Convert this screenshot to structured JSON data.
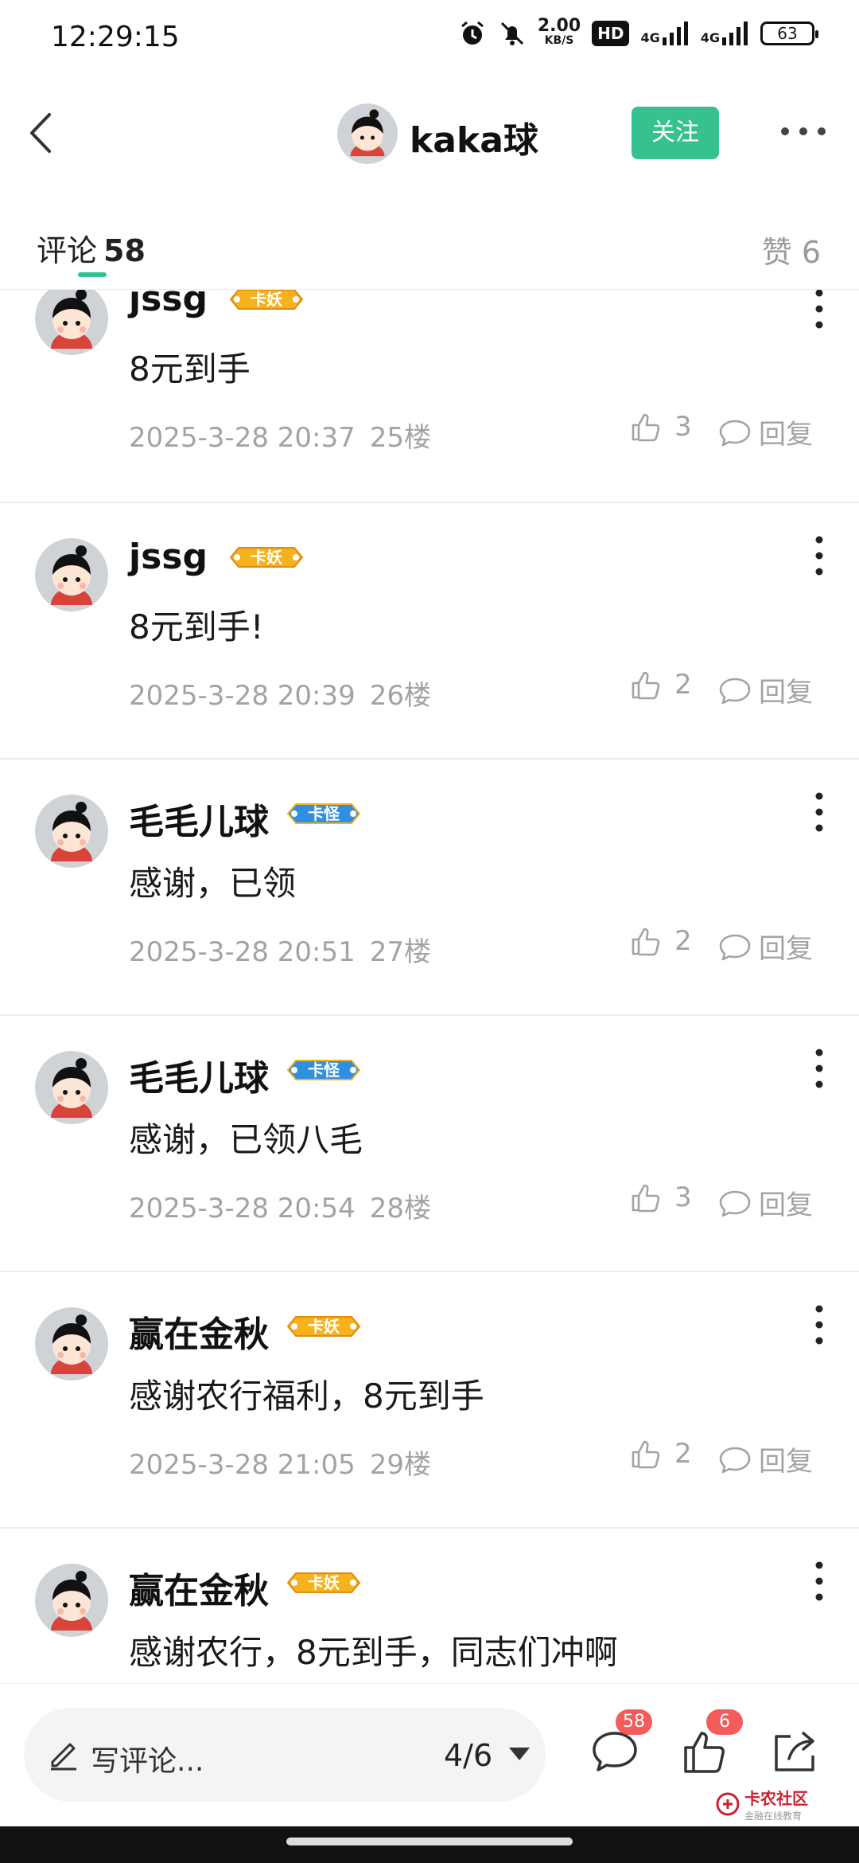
{
  "status_bar": {
    "time": "12:29:15",
    "net_speed_value": "2.00",
    "net_speed_unit": "KB/S",
    "hd_label": "HD",
    "signal1_label": "4G",
    "signal2_label": "4G",
    "battery": "63",
    "icons": [
      "alarm-icon",
      "mute-icon",
      "hd-icon",
      "signal-icon",
      "signal-icon",
      "battery-icon"
    ]
  },
  "header": {
    "user_name": "kaka球",
    "follow_label": "关注",
    "accent_color": "#35c28f"
  },
  "tabs": {
    "comments_label": "评论",
    "comments_count": "58",
    "likes_label": "赞 6"
  },
  "comments": [
    {
      "name": "jssg",
      "badge": "卡妖",
      "text": "8元到手",
      "time": "2025-3-28 20:37",
      "floor": "25楼",
      "likes": "3",
      "reply_label": "回复"
    },
    {
      "name": "jssg",
      "badge": "卡妖",
      "text": "8元到手!",
      "time": "2025-3-28 20:39",
      "floor": "26楼",
      "likes": "2",
      "reply_label": "回复"
    },
    {
      "name": "毛毛儿球",
      "badge": "卡怪",
      "text": "感谢，已领",
      "time": "2025-3-28 20:51",
      "floor": "27楼",
      "likes": "2",
      "reply_label": "回复"
    },
    {
      "name": "毛毛儿球",
      "badge": "卡怪",
      "text": "感谢，已领八毛",
      "time": "2025-3-28 20:54",
      "floor": "28楼",
      "likes": "3",
      "reply_label": "回复"
    },
    {
      "name": "赢在金秋",
      "badge": "卡妖",
      "text": "感谢农行福利，8元到手",
      "time": "2025-3-28 21:05",
      "floor": "29楼",
      "likes": "2",
      "reply_label": "回复"
    },
    {
      "name": "赢在金秋",
      "badge": "卡妖",
      "text": "感谢农行，8元到手，同志们冲啊",
      "time": "",
      "floor": "",
      "likes": "",
      "reply_label": ""
    }
  ],
  "bottom_bar": {
    "write_placeholder": "写评论...",
    "page_indicator": "4/6",
    "comments_badge": "58",
    "likes_badge": "6",
    "watermark_title": "卡农社区",
    "watermark_sub": "金融在线教育"
  }
}
